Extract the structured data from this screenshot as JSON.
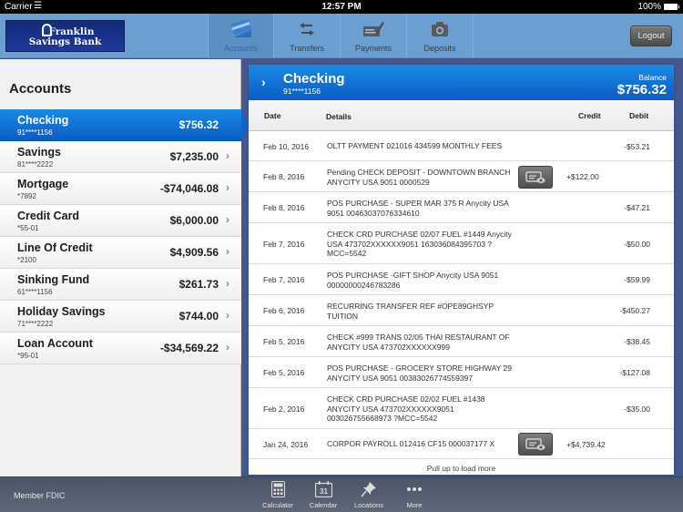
{
  "status_bar": {
    "carrier": "Carrier",
    "time": "12:57 PM",
    "battery": "100%"
  },
  "header": {
    "logo_line1": "Franklin",
    "logo_line2": "Savings Bank",
    "tabs": [
      {
        "label": "Accounts",
        "icon": "credit-card-icon",
        "active": true
      },
      {
        "label": "Transfers",
        "icon": "transfer-arrows-icon",
        "active": false
      },
      {
        "label": "Payments",
        "icon": "check-pen-icon",
        "active": false
      },
      {
        "label": "Deposits",
        "icon": "camera-icon",
        "active": false
      }
    ],
    "logout_label": "Logout"
  },
  "accounts_panel": {
    "title": "Accounts",
    "accounts": [
      {
        "name": "Checking",
        "number": "91****1156",
        "balance": "$756.32",
        "selected": true
      },
      {
        "name": "Savings",
        "number": "81****2222",
        "balance": "$7,235.00",
        "selected": false
      },
      {
        "name": "Mortgage",
        "number": "*7892",
        "balance": "-$74,046.08",
        "selected": false
      },
      {
        "name": "Credit Card",
        "number": "*55-01",
        "balance": "$6,000.00",
        "selected": false
      },
      {
        "name": "Line Of Credit",
        "number": "*2100",
        "balance": "$4,909.56",
        "selected": false
      },
      {
        "name": "Sinking Fund",
        "number": "61****1156",
        "balance": "$261.73",
        "selected": false
      },
      {
        "name": "Holiday Savings",
        "number": "71****2222",
        "balance": "$744.00",
        "selected": false
      },
      {
        "name": "Loan Account",
        "number": "*95-01",
        "balance": "-$34,569.22",
        "selected": false
      }
    ]
  },
  "account_detail": {
    "title": "Checking",
    "number": "91****1156",
    "balance_label": "Balance",
    "balance": "$756.32",
    "columns": {
      "date": "Date",
      "details": "Details",
      "credit": "Credit",
      "debit": "Debit"
    },
    "transactions": [
      {
        "date": "Feb 10, 2016",
        "details": "OLTT PAYMENT 021016 434599 MONTHLY FEES",
        "credit": "",
        "debit": "-$53.21",
        "has_image": false,
        "lines": 1
      },
      {
        "date": "Feb 8, 2016",
        "details": "Pending CHECK DEPOSIT - DOWNTOWN BRANCH ANYCITY USA 9051 0000529",
        "credit": "+$122.00",
        "debit": "",
        "has_image": true,
        "lines": 2
      },
      {
        "date": "Feb 8, 2016",
        "details": "POS PURCHASE -  SUPER MAR 375 R Anycity USA 9051 00463037076334610",
        "credit": "",
        "debit": "-$47.21",
        "has_image": false,
        "lines": 2
      },
      {
        "date": "Feb 7, 2016",
        "details": "CHECK CRD PURCHASE 02/07  FUEL #1449 Anycity USA 473702XXXXXX9051 163036084395703 ?MCC=5542",
        "credit": "",
        "debit": "-$50.00",
        "has_image": false,
        "lines": 3
      },
      {
        "date": "Feb 7, 2016",
        "details": "POS PURCHASE -GIFT SHOP Anycity USA 9051 00000000246783286",
        "credit": "",
        "debit": "-$59.99",
        "has_image": false,
        "lines": 2
      },
      {
        "date": "Feb 6, 2016",
        "details": "RECURRING TRANSFER REF #OPE89GHSYP TUITION",
        "credit": "",
        "debit": "-$450.27",
        "has_image": false,
        "lines": 2
      },
      {
        "date": "Feb 5, 2016",
        "details": "CHECK #999 TRANS 02/05 THAI RESTAURANT OF ANYCITY USA 473702XXXXXX999",
        "credit": "",
        "debit": "-$38.45",
        "has_image": false,
        "lines": 2
      },
      {
        "date": "Feb 5, 2016",
        "details": "POS PURCHASE - GROCERY STORE HIGHWAY 29 ANYCITY USA 9051 00383026774559397",
        "credit": "",
        "debit": "-$127.08",
        "has_image": false,
        "lines": 2
      },
      {
        "date": "Feb 2, 2016",
        "details": "CHECK CRD PURCHASE 02/02 FUEL #1438 ANYCITY USA 473702XXXXXX9051 003026755668973 ?MCC=5542",
        "credit": "",
        "debit": "-$35.00",
        "has_image": false,
        "lines": 3
      },
      {
        "date": "Jan 24, 2016",
        "details": "CORPOR PAYROLL 012416 CF15 000037177 X",
        "credit": "+$4,739.42",
        "debit": "",
        "has_image": true,
        "lines": 1
      }
    ],
    "load_more": "Pull up to load more"
  },
  "footer": {
    "fdic": "Member FDIC",
    "tools": [
      {
        "label": "Calculator",
        "icon": "calculator-icon"
      },
      {
        "label": "Calendar",
        "icon": "calendar-icon",
        "day": "31"
      },
      {
        "label": "Locations",
        "icon": "pushpin-icon"
      },
      {
        "label": "More",
        "icon": "more-dots-icon"
      }
    ]
  },
  "colors": {
    "nav_bg": "#6b9fd1",
    "accent_blue": "#1a8ae6",
    "app_bg": "#44578f",
    "footer_bg": "#4b5568"
  }
}
